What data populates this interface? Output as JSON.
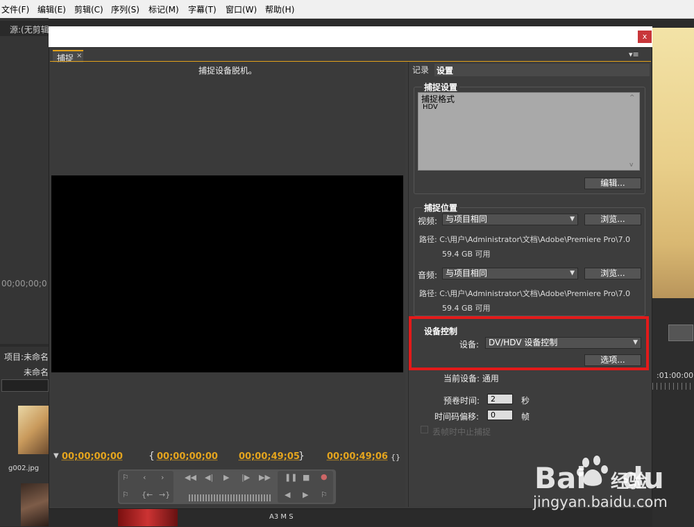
{
  "menu": {
    "items": [
      "文件(F)",
      "编辑(E)",
      "剪辑(C)",
      "序列(S)",
      "标记(M)",
      "字幕(T)",
      "窗口(W)",
      "帮助(H)"
    ]
  },
  "background": {
    "source_tab": "源:(无剪辑",
    "timecode": "00;00;00;0",
    "project_label": "项目:未命名",
    "project_name": "未命名",
    "thumb_label": "g002.jpg",
    "right_timecode": ":01:00:00",
    "track_labels": "A3  M  S"
  },
  "dialog": {
    "close": "x",
    "tab_label": "捕捉",
    "tab_close": "×",
    "panel_menu": "▾≡",
    "offline_message": "捕捉设备脱机。",
    "timecodes": {
      "current": "00;00;00;00",
      "in_point": "00;00;00;00",
      "out_point": "00;00;49;05",
      "duration": "00;00;49;06"
    },
    "right": {
      "tab_log": "记录",
      "tab_settings": "设置",
      "capture_settings": {
        "title": "捕捉设置",
        "format_header": "捕捉格式",
        "format_value": "HDV",
        "edit_button": "编辑..."
      },
      "capture_location": {
        "title": "捕捉位置",
        "video_label": "视频:",
        "video_value": "与项目相同",
        "browse_button": "浏览...",
        "video_path": "路径: C:\\用户\\Administrator\\文档\\Adobe\\Premiere Pro\\7.0",
        "video_free": "59.4 GB 可用",
        "audio_label": "音频:",
        "audio_value": "与项目相同",
        "audio_path": "路径: C:\\用户\\Administrator\\文档\\Adobe\\Premiere Pro\\7.0",
        "audio_free": "59.4 GB 可用"
      },
      "device_control": {
        "title": "设备控制",
        "device_label": "设备:",
        "device_value": "DV/HDV 设备控制",
        "options_button": "选项...",
        "current_device": "当前设备: 通用",
        "preroll_label": "预卷时间:",
        "preroll_value": "2",
        "preroll_unit": "秒",
        "offset_label": "时间码偏移:",
        "offset_value": "0",
        "offset_unit": "帧",
        "abort_label": "丢帧时中止捕捉"
      }
    }
  },
  "watermark": {
    "brand": "Bai",
    "brand2": "du",
    "jingyan": "经验",
    "url": "jingyan.baidu.com"
  },
  "colors": {
    "accent_orange": "#e5a51e",
    "highlight_red": "#e31a1a",
    "close_red": "#c8363a"
  }
}
